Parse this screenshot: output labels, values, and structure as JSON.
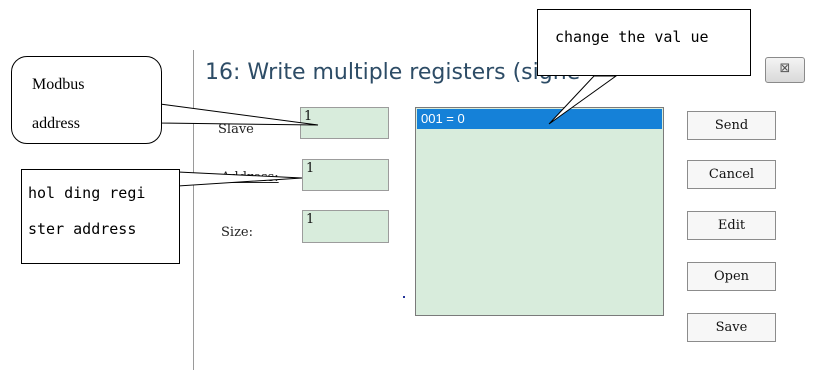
{
  "dialog": {
    "title": "16: Write multiple registers (signe",
    "close_glyph": "⊠",
    "fields": {
      "slave_label": "Slave",
      "slave_value": "1",
      "address_label": "Address:",
      "address_value": "1",
      "size_label": "Size:",
      "size_value": "1"
    },
    "list": {
      "items": [
        "001 = 0"
      ]
    },
    "buttons": {
      "send": "Send",
      "cancel": "Cancel",
      "edit": "Edit",
      "open": "Open",
      "save": "Save"
    }
  },
  "annotations": {
    "modbus_line1": "Modbus",
    "modbus_line2": "address",
    "holding_line1": "hol ding regi",
    "holding_line2": "ster address",
    "change_value": "change the val ue"
  },
  "colors": {
    "field_bg": "#d8ecdc",
    "selection": "#1581d8",
    "title": "#2d4c66"
  }
}
